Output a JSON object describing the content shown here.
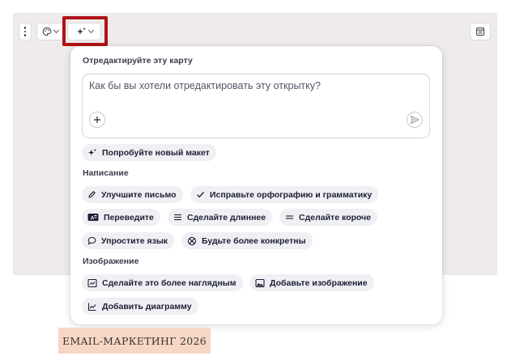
{
  "toolbar": {
    "more_icon": "more-vertical-icon",
    "theme_icon": "palette-icon",
    "ai_icon": "sparkle-icon",
    "notes_icon": "notes-icon",
    "highlight_color": "#b01217"
  },
  "popup": {
    "title": "Отредактируйте эту карту",
    "prompt_placeholder": "Как бы вы хотели отредактировать эту открытку?",
    "try_layout": "Попробуйте новый макет",
    "writing_section": "Написание",
    "writing": {
      "improve": "Улучшите письмо",
      "fix_spelling": "Исправьте орфографию и грамматику",
      "translate": "Переведите",
      "longer": "Сделайте длиннее",
      "shorter": "Сделайте короче",
      "simplify": "Упростите язык",
      "specific": "Будьте более конкретны"
    },
    "image_section": "Изображение",
    "image": {
      "visual": "Сделайте это более наглядным",
      "add_image": "Добавьте изображение",
      "add_chart": "Добавить диаграмму"
    }
  },
  "card": {
    "tag": "EMAIL-МАРКЕТИНГ 2026",
    "bg_color": "#efebea",
    "tag_color": "#f6d6c4"
  }
}
